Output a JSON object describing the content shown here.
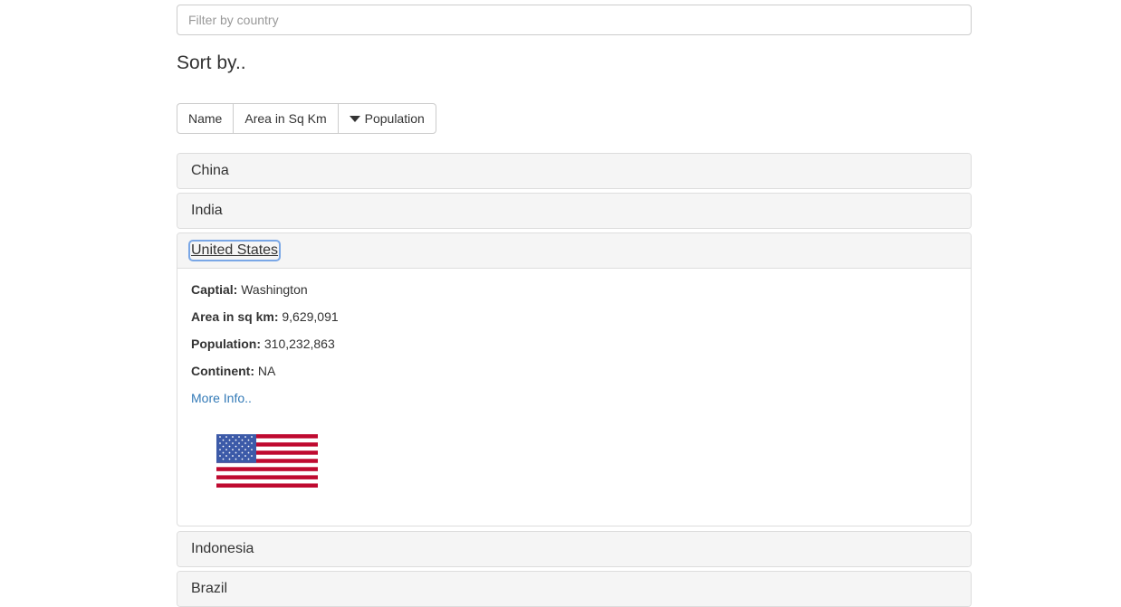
{
  "filter": {
    "placeholder": "Filter by country",
    "value": ""
  },
  "sort": {
    "heading": "Sort by..",
    "buttons": [
      {
        "label": "Name"
      },
      {
        "label": "Area in Sq Km"
      },
      {
        "label": "Population",
        "icon": "caret-down-icon"
      }
    ]
  },
  "countries": [
    {
      "name": "China"
    },
    {
      "name": "India"
    },
    {
      "name": "United States",
      "expanded": true,
      "capital_label": "Captial:",
      "capital": "Washington",
      "area_label": "Area in sq km:",
      "area": "9,629,091",
      "population_label": "Population:",
      "population": "310,232,863",
      "continent_label": "Continent:",
      "continent": "NA",
      "more_info": "More Info..",
      "flag": "us-flag"
    },
    {
      "name": "Indonesia"
    },
    {
      "name": "Brazil"
    }
  ],
  "colors": {
    "link": "#337ab7",
    "panel_heading": "#f5f5f5",
    "flag_red": "#bf0a30",
    "flag_blue": "#3c5aa8"
  }
}
